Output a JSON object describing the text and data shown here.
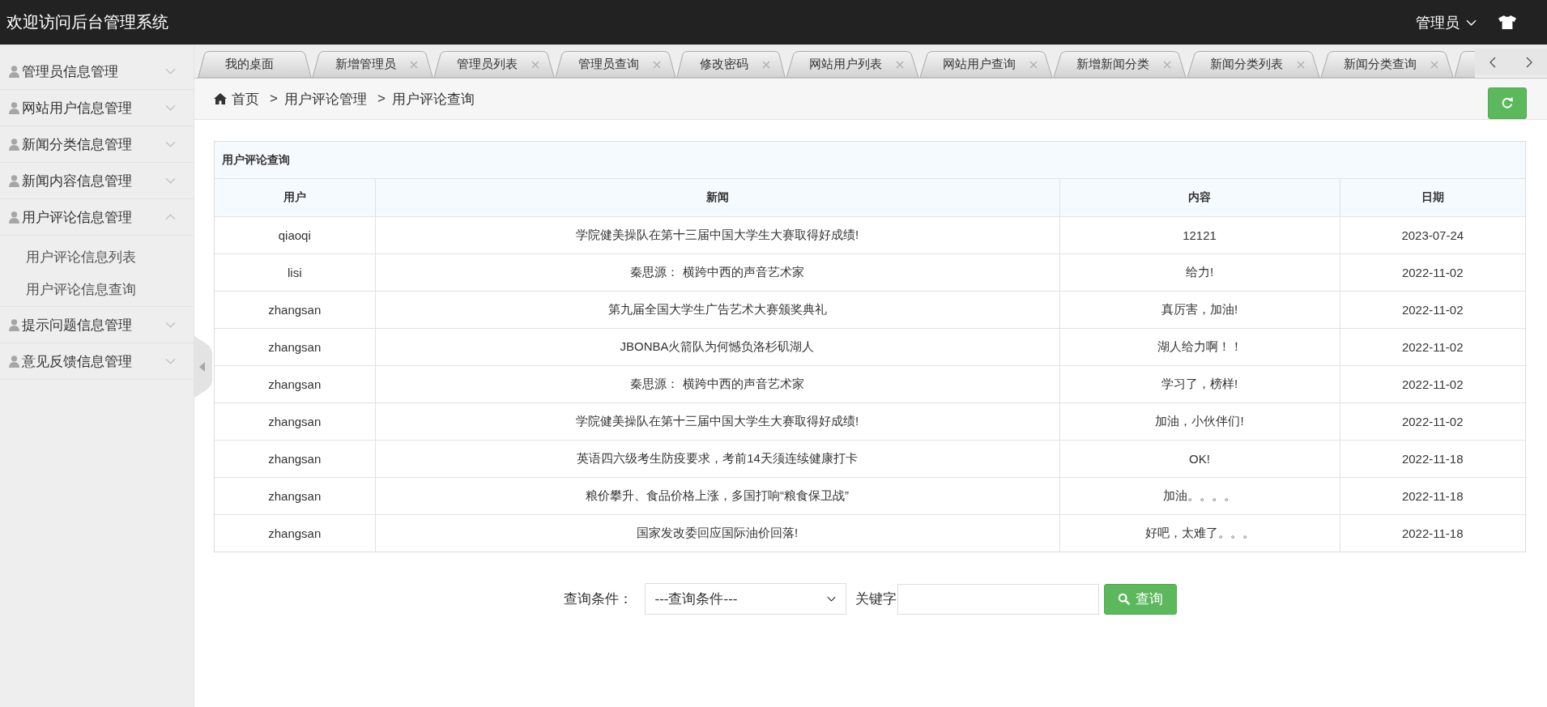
{
  "header": {
    "title": "欢迎访问后台管理系统",
    "user_menu": "管理员"
  },
  "sidebar": {
    "items": [
      {
        "label": "管理员信息管理",
        "expanded": false
      },
      {
        "label": "网站用户信息管理",
        "expanded": false
      },
      {
        "label": "新闻分类信息管理",
        "expanded": false
      },
      {
        "label": "新闻内容信息管理",
        "expanded": false
      },
      {
        "label": "用户评论信息管理",
        "expanded": true,
        "children": [
          {
            "label": "用户评论信息列表",
            "selected": false
          },
          {
            "label": "用户评论信息查询",
            "selected": false
          }
        ]
      },
      {
        "label": "提示问题信息管理",
        "expanded": false
      },
      {
        "label": "意见反馈信息管理",
        "expanded": false
      }
    ]
  },
  "tabs": [
    {
      "label": "我的桌面",
      "closable": false,
      "selected": false
    },
    {
      "label": "新增管理员",
      "closable": true,
      "selected": false
    },
    {
      "label": "管理员列表",
      "closable": true,
      "selected": false
    },
    {
      "label": "管理员查询",
      "closable": true,
      "selected": false
    },
    {
      "label": "修改密码",
      "closable": true,
      "selected": false
    },
    {
      "label": "网站用户列表",
      "closable": true,
      "selected": false
    },
    {
      "label": "网站用户查询",
      "closable": true,
      "selected": false
    },
    {
      "label": "新增新闻分类",
      "closable": true,
      "selected": false
    },
    {
      "label": "新闻分类列表",
      "closable": true,
      "selected": false
    },
    {
      "label": "新闻分类查询",
      "closable": true,
      "selected": false
    }
  ],
  "breadcrumb": [
    {
      "kind": "home",
      "text": "首页"
    },
    {
      "kind": "separator",
      "text": ">"
    },
    {
      "kind": "link",
      "text": "用户评论管理"
    },
    {
      "kind": "separator",
      "text": ">"
    },
    {
      "kind": "current",
      "text": "用户评论查询"
    }
  ],
  "table": {
    "title": "用户评论查询",
    "columns": [
      "用户",
      "新闻",
      "内容",
      "日期"
    ],
    "rows": [
      [
        "qiaoqi",
        "学院健美操队在第十三届中国大学生大赛取得好成绩!",
        "12121",
        "2023-07-24"
      ],
      [
        "lisi",
        "秦思源： 横跨中西的声音艺术家",
        "给力!",
        "2022-11-02"
      ],
      [
        "zhangsan",
        "第九届全国大学生广告艺术大赛颁奖典礼",
        "真厉害，加油!",
        "2022-11-02"
      ],
      [
        "zhangsan",
        "JBONBA火箭队为何憾负洛杉矶湖人",
        "湖人给力啊！！",
        "2022-11-02"
      ],
      [
        "zhangsan",
        "秦思源： 横跨中西的声音艺术家",
        "学习了，榜样!",
        "2022-11-02"
      ],
      [
        "zhangsan",
        "学院健美操队在第十三届中国大学生大赛取得好成绩!",
        "加油，小伙伴们!",
        "2022-11-02"
      ],
      [
        "zhangsan",
        "英语四六级考生防疫要求，考前14天须连续健康打卡",
        "OK!",
        "2022-11-18"
      ],
      [
        "zhangsan",
        "粮价攀升、食品价格上涨，多国打响“粮食保卫战”",
        "加油。。。。",
        "2022-11-18"
      ],
      [
        "zhangsan",
        "国家发改委回应国际油价回落!",
        "好吧，太难了。。。",
        "2022-11-18"
      ]
    ]
  },
  "query": {
    "condition_label": "查询条件：",
    "condition_select": "---查询条件---",
    "keyword_label": "关键字",
    "button": "查询"
  }
}
